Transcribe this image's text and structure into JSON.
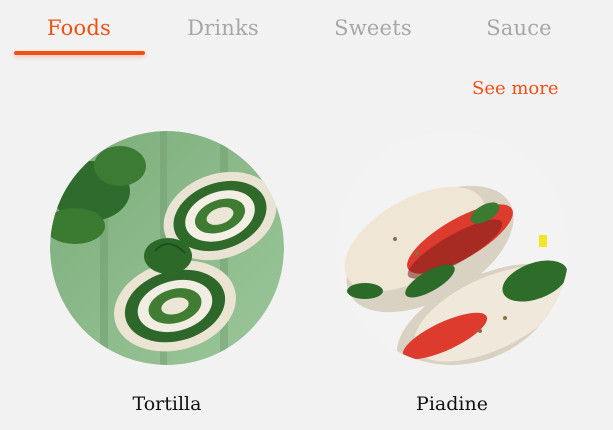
{
  "tabs": [
    {
      "label": "Foods",
      "active": true
    },
    {
      "label": "Drinks",
      "active": false
    },
    {
      "label": "Sweets",
      "active": false
    },
    {
      "label": "Sauce",
      "active": false
    }
  ],
  "see_more_label": "See more",
  "colors": {
    "accent": "#f24f12",
    "inactive_tab": "#a7a7a7",
    "background": "#f2f2f2"
  },
  "items": [
    {
      "name": "Tortilla"
    },
    {
      "name": "Piadine"
    }
  ]
}
